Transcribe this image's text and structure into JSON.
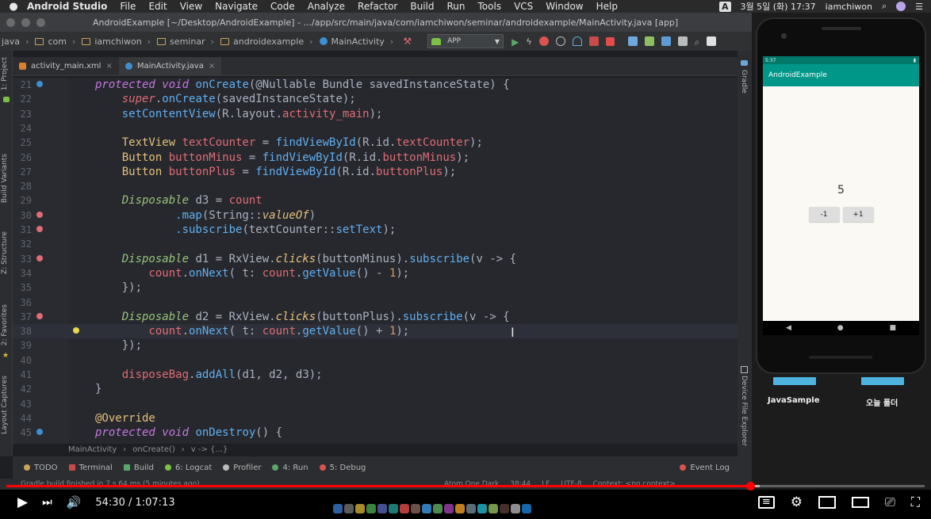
{
  "menubar": {
    "apple": "",
    "app": "Android Studio",
    "items": [
      "File",
      "Edit",
      "View",
      "Navigate",
      "Code",
      "Analyze",
      "Refactor",
      "Build",
      "Run",
      "Tools",
      "VCS",
      "Window",
      "Help"
    ],
    "input_badge": "A",
    "datetime": "3월 5일 (화) 17:37",
    "user": "iamchiwon"
  },
  "window_title": "AndroidExample [~/Desktop/AndroidExample] - .../app/src/main/java/com/iamchiwon/seminar/androidexample/MainActivity.java [app]",
  "breadcrumb": [
    "java",
    "com",
    "iamchiwon",
    "seminar",
    "androidexample",
    "MainActivity"
  ],
  "run_config": "APP",
  "left_tool_labels": [
    "1: Project",
    "Build Variants",
    "Z: Structure",
    "2: Favorites",
    "Layout Captures"
  ],
  "right_tool_labels": [
    "Gradle",
    "Device File Explorer"
  ],
  "tabs": [
    {
      "label": "activity_main.xml"
    },
    {
      "label": "MainActivity.java"
    }
  ],
  "code_lines": [
    {
      "n": "21",
      "marker": "override"
    },
    {
      "n": "22",
      "marker": ""
    },
    {
      "n": "23",
      "marker": ""
    },
    {
      "n": "24",
      "marker": ""
    },
    {
      "n": "25",
      "marker": ""
    },
    {
      "n": "26",
      "marker": ""
    },
    {
      "n": "27",
      "marker": ""
    },
    {
      "n": "28",
      "marker": ""
    },
    {
      "n": "29",
      "marker": ""
    },
    {
      "n": "30",
      "marker": "lambda"
    },
    {
      "n": "31",
      "marker": "lambda"
    },
    {
      "n": "32",
      "marker": ""
    },
    {
      "n": "33",
      "marker": "lambda"
    },
    {
      "n": "34",
      "marker": ""
    },
    {
      "n": "35",
      "marker": ""
    },
    {
      "n": "36",
      "marker": ""
    },
    {
      "n": "37",
      "marker": "lambda"
    },
    {
      "n": "38",
      "marker": "bulb"
    },
    {
      "n": "39",
      "marker": ""
    },
    {
      "n": "40",
      "marker": ""
    },
    {
      "n": "41",
      "marker": ""
    },
    {
      "n": "42",
      "marker": ""
    },
    {
      "n": "43",
      "marker": ""
    },
    {
      "n": "44",
      "marker": ""
    },
    {
      "n": "45",
      "marker": "override"
    }
  ],
  "code": {
    "l21": [
      "protected void ",
      "onCreate",
      "(@Nullable Bundle savedInstanceState) {"
    ],
    "l22": [
      "    super",
      ".",
      "onCreate",
      "(savedInstanceState);"
    ],
    "l23": [
      "    setContentView",
      "(R.layout.",
      "activity_main",
      ");"
    ],
    "l25": [
      "    TextView ",
      "textCounter",
      " = ",
      "findViewById",
      "(R.id.",
      "textCounter",
      ");"
    ],
    "l26": [
      "    Button ",
      "buttonMinus",
      " = ",
      "findViewById",
      "(R.id.",
      "buttonMinus",
      ");"
    ],
    "l27": [
      "    Button ",
      "buttonPlus",
      " = ",
      "findViewById",
      "(R.id.",
      "buttonPlus",
      ");"
    ],
    "l29": [
      "    Disposable",
      " d3 = ",
      "count"
    ],
    "l30": [
      "            .map",
      "(String::",
      "valueOf",
      ")"
    ],
    "l31": [
      "            .subscribe",
      "(textCounter::",
      "setText",
      ");"
    ],
    "l33": [
      "    Disposable",
      " d1 = RxView.",
      "clicks",
      "(buttonMinus).",
      "subscribe",
      "(v -> {"
    ],
    "l34": [
      "        count",
      ".",
      "onNext",
      "( t: ",
      "count",
      ".",
      "getValue",
      "() - ",
      "1",
      ");"
    ],
    "l35": [
      "    });"
    ],
    "l37": [
      "    Disposable",
      " d2 = RxView.",
      "clicks",
      "(buttonPlus).",
      "subscribe",
      "(v -> {"
    ],
    "l38": [
      "        count",
      ".",
      "onNext",
      "( t: ",
      "count",
      ".",
      "getValue",
      "() + ",
      "1",
      ");"
    ],
    "l39": [
      "    });"
    ],
    "l41": [
      "    disposeBag",
      ".",
      "addAll",
      "(d1, d2, d3);"
    ],
    "l42": [
      "}"
    ],
    "l44": [
      "@Override"
    ],
    "l45": [
      "protected void ",
      "onDestroy",
      "() {"
    ]
  },
  "editor_breadcrumb": [
    "MainActivity",
    "onCreate()",
    "v -> {...}"
  ],
  "toolwindows": [
    "TODO",
    "Terminal",
    "Build",
    "6: Logcat",
    "Profiler",
    "4: Run",
    "5: Debug"
  ],
  "event_log": "Event Log",
  "status": {
    "message": "Gradle build finished in 7 s 64 ms (5 minutes ago)",
    "theme": "Atom One Dark",
    "position": "38:44",
    "line_sep": "LF",
    "encoding": "UTF-8",
    "context": "Context: <no context>"
  },
  "emulator": {
    "status_time": "5:37",
    "app_title": "AndroidExample",
    "counter": "5",
    "minus_label": "-1",
    "plus_label": "+1",
    "nav_back": "◀",
    "nav_home": "●",
    "nav_recent": "■"
  },
  "desktop": {
    "label_left": "JavaSample",
    "label_right": "오늘 폴더"
  },
  "player": {
    "time": "54:30 / 1:07:13",
    "played_fraction": 0.8104,
    "buffered_fraction": 0.82
  },
  "colors": {
    "accent_teal": "#009688",
    "progress_red": "#ff0000"
  }
}
